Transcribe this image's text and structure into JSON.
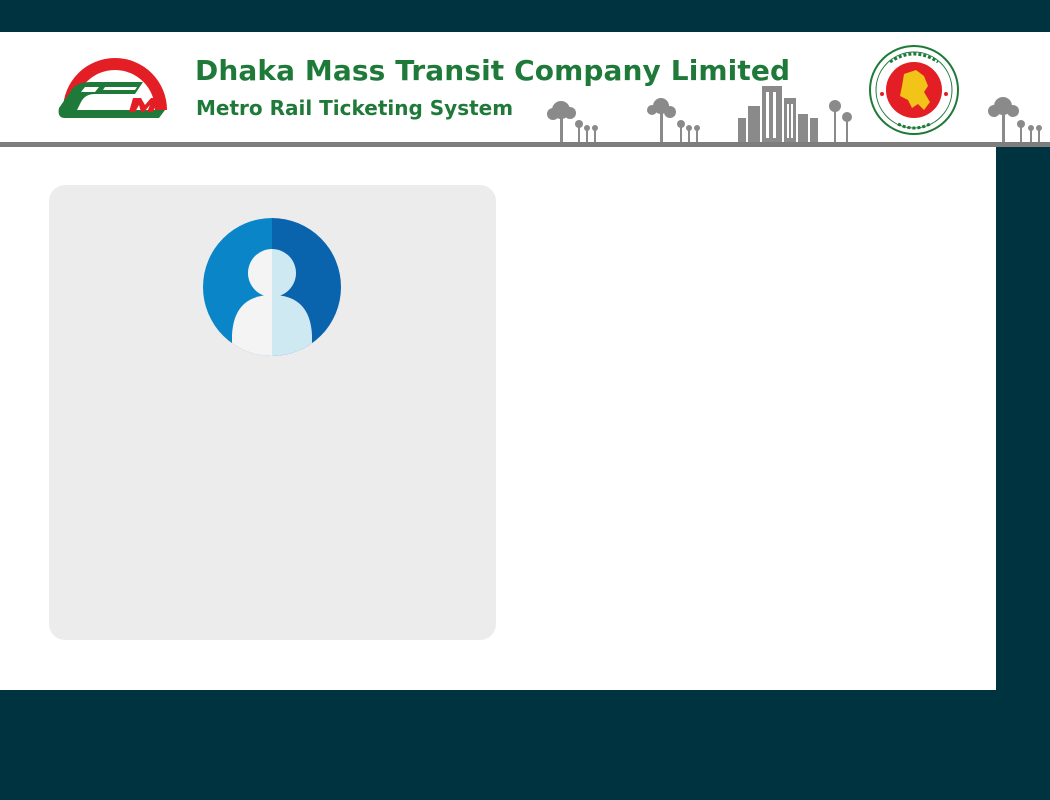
{
  "header": {
    "org_title": "Dhaka Mass Transit Company Limited",
    "org_subtitle": "Metro Rail Ticketing System",
    "logo_icon": "metro-rail-logo-icon",
    "seal_icon": "bangladesh-government-seal-icon",
    "skyline_icon": "city-skyline-illustration"
  },
  "profile": {
    "avatar_icon": "user-avatar-icon"
  },
  "colors": {
    "background": "#003340",
    "brand_green": "#1f7a3a",
    "brand_red": "#e31e24",
    "card": "#ececec",
    "avatar_blue": "#0a63ad"
  }
}
